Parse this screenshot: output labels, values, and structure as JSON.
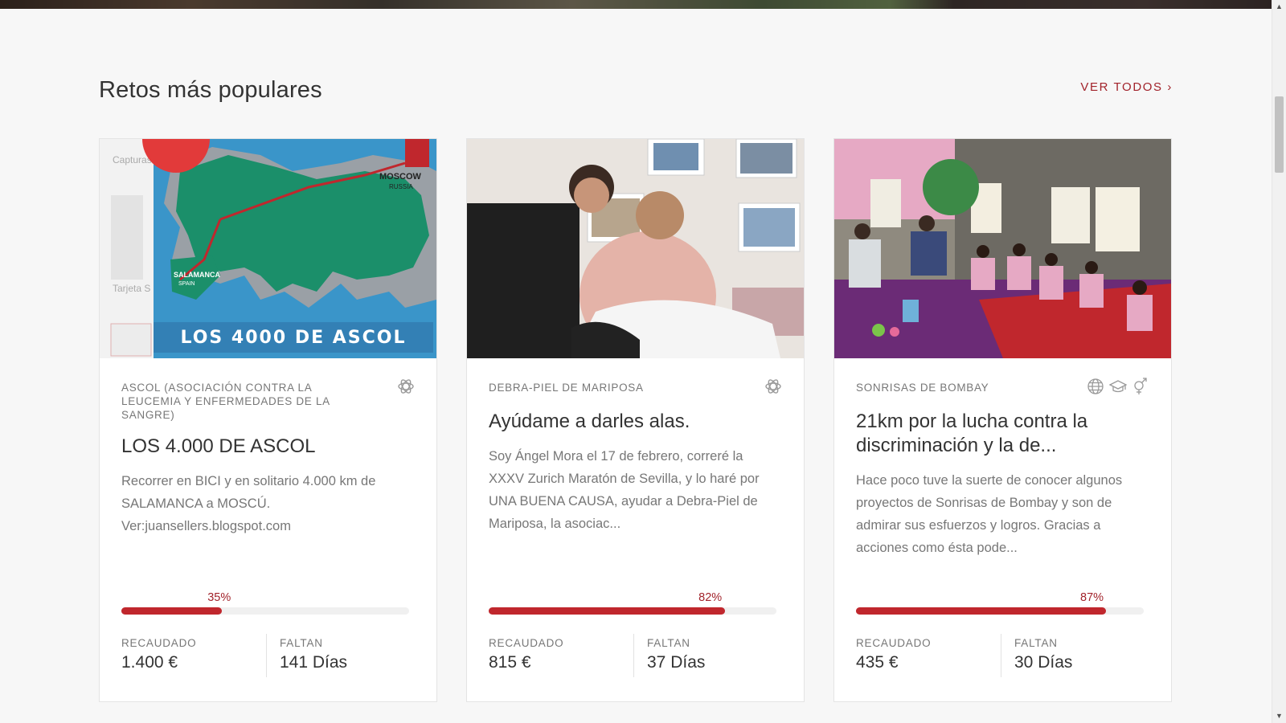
{
  "section": {
    "title": "Retos más populares",
    "see_all": "VER TODOS ›"
  },
  "cards": [
    {
      "org": "ASCOL (ASOCIACIÓN CONTRA LA LEUCEMIA Y ENFERMEDADES DE LA SANGRE)",
      "title": "LOS 4.000 DE ASCOL",
      "description": "Recorrer en BICI y en solitario 4.000 km de SALAMANCA a MOSCÚ. Ver:juansellers.blogspot.com",
      "percent": 35,
      "percent_label": "35%",
      "raised_label": "RECAUDADO",
      "raised_value": "1.400 €",
      "remaining_label": "FALTAN",
      "remaining_value": "141 Días",
      "image": {
        "banner": "LOS 4000 DE ASCOL",
        "city_start": "SALAMANCA",
        "country_start": "SPAIN",
        "city_end": "MOSCOW",
        "country_end": "RUSSIA",
        "bg_label_1": "Capturas",
        "bg_label_2": "Tarjeta S"
      },
      "icons": [
        "atom-icon"
      ]
    },
    {
      "org": "DEBRA-PIEL DE MARIPOSA",
      "title": "Ayúdame a darles alas.",
      "description": "Soy Ángel Mora el 17 de febrero, correré la XXXV Zurich Maratón de Sevilla, y lo haré por UNA BUENA CAUSA, ayudar a Debra-Piel de Mariposa, la asociac...",
      "percent": 82,
      "percent_label": "82%",
      "raised_label": "RECAUDADO",
      "raised_value": "815 €",
      "remaining_label": "FALTAN",
      "remaining_value": "37 Días",
      "icons": [
        "atom-icon"
      ]
    },
    {
      "org": "SONRISAS DE BOMBAY",
      "title": "21km por la lucha contra la discriminación y la de...",
      "description": "Hace poco tuve la suerte de conocer algunos proyectos de Sonrisas de Bombay y son de admirar sus esfuerzos y logros. Gracias a acciones como ésta pode...",
      "percent": 87,
      "percent_label": "87%",
      "raised_label": "RECAUDADO",
      "raised_value": "435 €",
      "remaining_label": "FALTAN",
      "remaining_value": "30 Días",
      "icons": [
        "globe-icon",
        "graduation-cap-icon",
        "gender-icon"
      ]
    }
  ],
  "colors": {
    "accent": "#a2232b",
    "progress_fill": "#c0272d",
    "progress_track": "#f0f0f0",
    "background": "#f7f7f7"
  }
}
